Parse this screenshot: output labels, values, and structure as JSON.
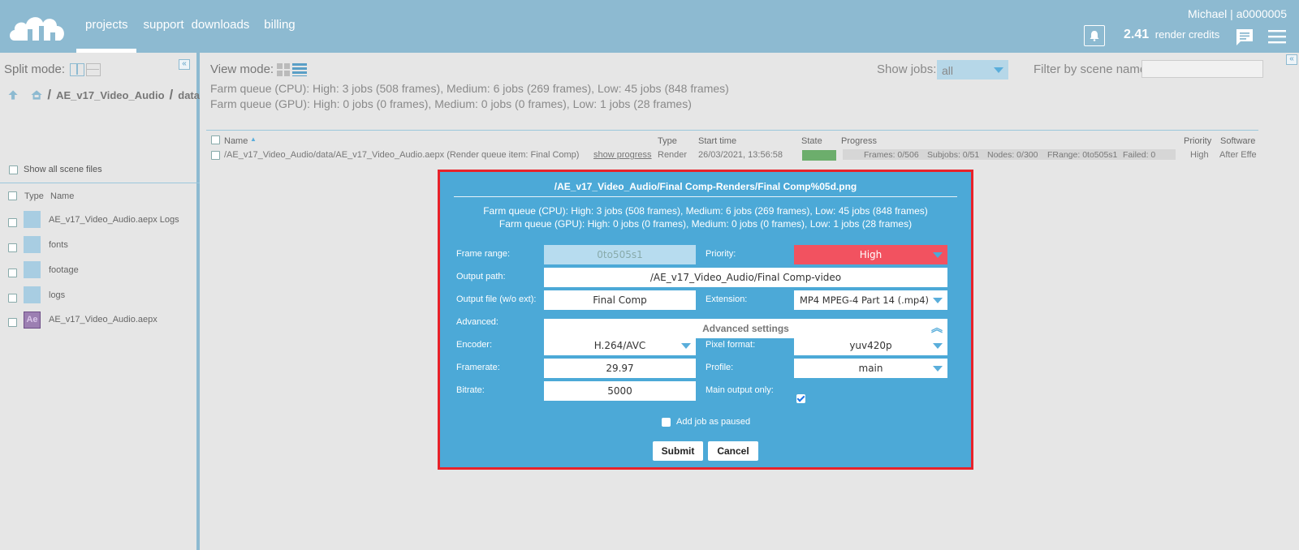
{
  "header": {
    "nav": [
      {
        "label": "projects"
      },
      {
        "label": "support"
      },
      {
        "label": "downloads"
      },
      {
        "label": "billing"
      }
    ],
    "user": "Michael | a0000005",
    "credits_value": "2.41",
    "credits_label": "render credits",
    "icons": {
      "logo": "cloud-logo",
      "bell": "bell-icon",
      "chat": "chat-icon",
      "menu": "hamburger-menu-icon"
    }
  },
  "left": {
    "split_mode_label": "Split mode:",
    "collapse_symbol": "«",
    "breadcrumb": [
      "AE_v17_Video_Audio",
      "data"
    ],
    "breadcrumb_sep": "/",
    "show_all_label": "Show all scene files",
    "columns": {
      "type": "Type",
      "name": "Name"
    },
    "files": [
      {
        "name": "AE_v17_Video_Audio.aepx Logs",
        "kind": "folder"
      },
      {
        "name": "fonts",
        "kind": "folder"
      },
      {
        "name": "footage",
        "kind": "folder"
      },
      {
        "name": "logs",
        "kind": "folder"
      },
      {
        "name": "AE_v17_Video_Audio.aepx",
        "kind": "ae",
        "icon_text": "Ae"
      }
    ]
  },
  "main": {
    "view_mode_label": "View mode:",
    "farm_cpu": "Farm queue (CPU): High: 3 jobs (508 frames), Medium: 6 jobs (269 frames), Low: 45 jobs (848 frames)",
    "farm_gpu": "Farm queue (GPU): High: 0 jobs (0 frames), Medium: 0 jobs (0 frames), Low: 1 jobs (28 frames)",
    "show_jobs_label": "Show jobs:",
    "show_jobs_value": "all",
    "filter_label": "Filter by scene name:",
    "columns": {
      "name": "Name",
      "type": "Type",
      "start": "Start time",
      "state": "State",
      "progress": "Progress",
      "priority": "Priority",
      "software": "Software"
    },
    "job": {
      "name": "/AE_v17_Video_Audio/data/AE_v17_Video_Audio.aepx (Render queue item: Final Comp)",
      "show_progress": "show progress",
      "type": "Render",
      "start": "26/03/2021, 13:56:58",
      "frames": "Frames: 0/506",
      "subjobs": "Subjobs: 0/51",
      "nodes": "Nodes: 0/300",
      "frange": "FRange: 0to505s1",
      "failed": "Failed: 0",
      "priority": "High",
      "software": "After Effe"
    }
  },
  "dialog": {
    "title": "/AE_v17_Video_Audio/Final Comp-Renders/Final Comp%05d.png",
    "farm_cpu": "Farm queue (CPU): High: 3 jobs (508 frames), Medium: 6 jobs (269 frames), Low: 45 jobs (848 frames)",
    "farm_gpu": "Farm queue (GPU): High: 0 jobs (0 frames), Medium: 0 jobs (0 frames), Low: 1 jobs (28 frames)",
    "labels": {
      "frame_range": "Frame range:",
      "priority": "Priority:",
      "output_path": "Output path:",
      "output_file": "Output file (w/o ext):",
      "extension": "Extension:",
      "advanced": "Advanced:",
      "encoder": "Encoder:",
      "pixel_format": "Pixel format:",
      "framerate": "Framerate:",
      "profile": "Profile:",
      "bitrate": "Bitrate:",
      "main_output_only": "Main output only:"
    },
    "values": {
      "frame_range": "0to505s1",
      "priority": "High",
      "output_path": "/AE_v17_Video_Audio/Final Comp-video",
      "output_file": "Final Comp",
      "extension": "MP4 MPEG-4 Part 14 (.mp4)",
      "advanced": "Advanced settings",
      "encoder": "H.264/AVC",
      "pixel_format": "yuv420p",
      "framerate": "29.97",
      "profile": "main",
      "bitrate": "5000"
    },
    "add_paused_label": "Add job as paused",
    "submit_label": "Submit",
    "cancel_label": "Cancel",
    "colors": {
      "panel": "#4ca9d7",
      "highlight_border": "#e8222a",
      "priority_high": "#f25260"
    }
  }
}
